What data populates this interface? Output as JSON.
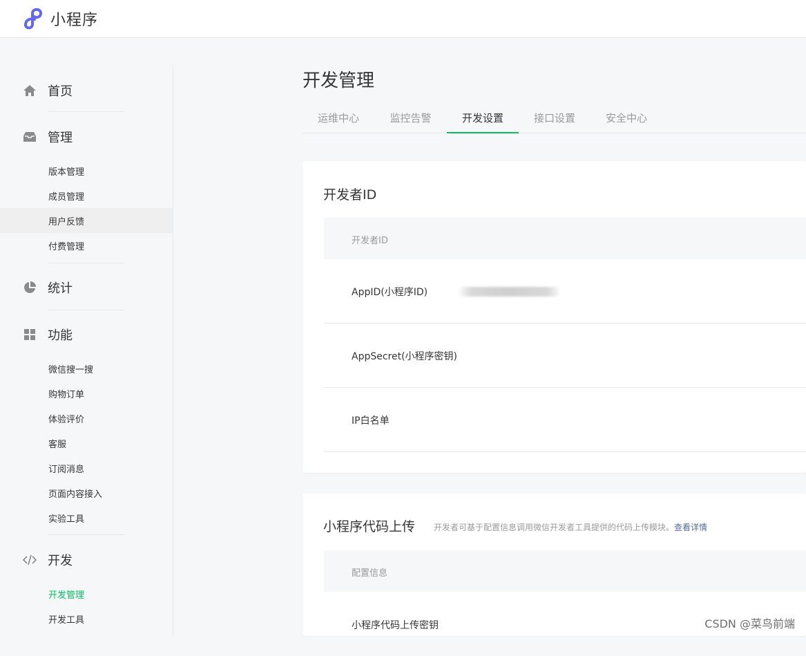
{
  "header": {
    "brand": "小程序"
  },
  "sidebar": {
    "home": {
      "label": "首页"
    },
    "manage": {
      "label": "管理",
      "items": [
        "版本管理",
        "成员管理",
        "用户反馈",
        "付费管理"
      ]
    },
    "stats": {
      "label": "统计"
    },
    "features": {
      "label": "功能",
      "items": [
        "微信搜一搜",
        "购物订单",
        "体验评价",
        "客服",
        "订阅消息",
        "页面内容接入",
        "实验工具"
      ]
    },
    "dev": {
      "label": "开发",
      "items": [
        "开发管理",
        "开发工具"
      ]
    }
  },
  "main": {
    "title": "开发管理",
    "tabs": [
      "运维中心",
      "监控告警",
      "开发设置",
      "接口设置",
      "安全中心"
    ],
    "active_tab": "开发设置",
    "developer_card": {
      "title": "开发者ID",
      "table_header": "开发者ID",
      "rows": [
        "AppID(小程序ID)",
        "AppSecret(小程序密钥)",
        "IP白名单"
      ]
    },
    "upload_card": {
      "title": "小程序代码上传",
      "description": "开发者可基于配置信息调用微信开发者工具提供的代码上传模块。",
      "link": "查看详情",
      "table_header": "配置信息",
      "rows": [
        "小程序代码上传密钥"
      ]
    }
  },
  "watermark": "CSDN @菜鸟前端",
  "colors": {
    "accent": "#07c160",
    "link": "#576b95",
    "logo": "#6467f0"
  }
}
